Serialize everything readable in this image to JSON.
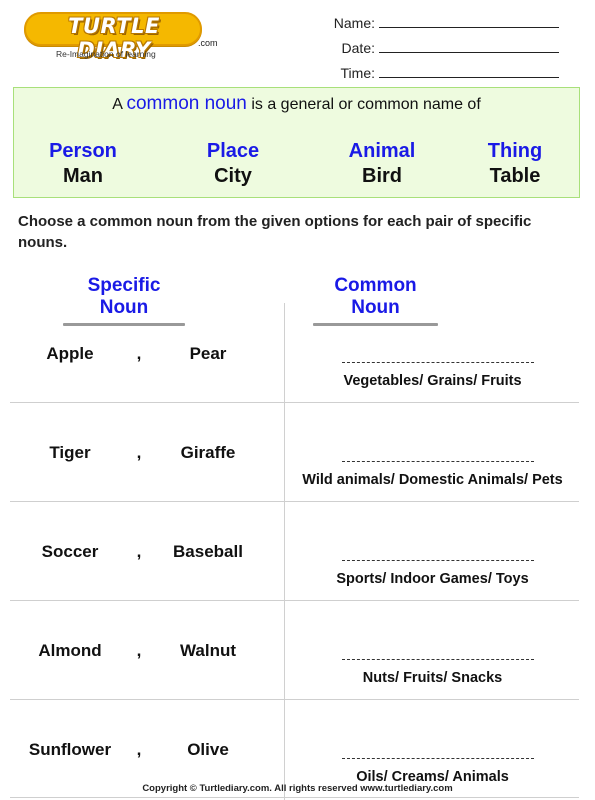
{
  "logo": {
    "name": "TURTLE DIARY",
    "domain_suffix": ".com",
    "tagline": "Re-Imagination of learning",
    "brand_color": "#f5b800"
  },
  "meta_fields": [
    {
      "label": "Name:"
    },
    {
      "label": "Date:"
    },
    {
      "label": "Time:"
    }
  ],
  "definition": {
    "prefix": "A",
    "highlight": "common noun",
    "suffix": "is a general or common name of",
    "categories": [
      {
        "category": "Person",
        "example": "Man"
      },
      {
        "category": "Place",
        "example": "City"
      },
      {
        "category": "Animal",
        "example": "Bird"
      },
      {
        "category": "Thing",
        "example": "Table"
      }
    ],
    "box_color": "#eefbdf",
    "accent_color": "#1a1ae6"
  },
  "instruction": "Choose a common noun from the given options for each pair of specific nouns.",
  "columns": {
    "specific": "Specific Noun",
    "common": "Common Noun"
  },
  "rows": [
    {
      "word1": "Apple",
      "separator": ",",
      "word2": "Pear",
      "options": "Vegetables/  Grains/  Fruits"
    },
    {
      "word1": "Tiger",
      "separator": ",",
      "word2": "Giraffe",
      "options": "Wild animals/  Domestic Animals/  Pets"
    },
    {
      "word1": "Soccer",
      "separator": ",",
      "word2": "Baseball",
      "options": "Sports/  Indoor Games/  Toys"
    },
    {
      "word1": "Almond",
      "separator": ",",
      "word2": "Walnut",
      "options": "Nuts/  Fruits/  Snacks"
    },
    {
      "word1": "Sunflower",
      "separator": ",",
      "word2": "Olive",
      "options": "Oils/  Creams/  Animals"
    }
  ],
  "footer": "Copyright © Turtlediary.com. All rights reserved  www.turtlediary.com"
}
